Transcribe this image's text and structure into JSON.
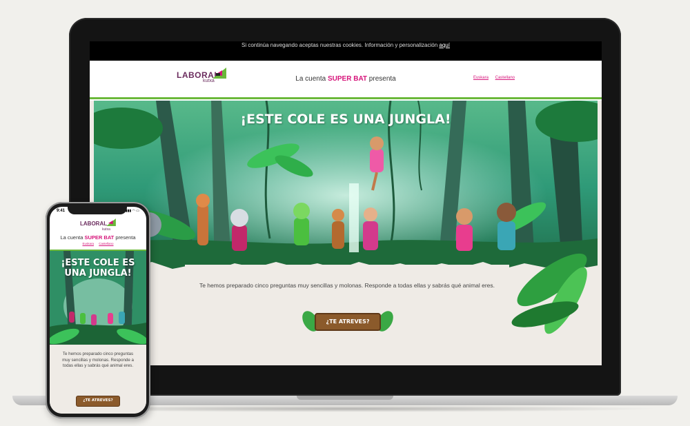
{
  "desktop": {
    "cookie_bar": {
      "text": "Si continúa navegando aceptas nuestras cookies. Información y personalización ",
      "link": "aquí"
    },
    "header": {
      "logo_text": "LABORAL",
      "logo_sub": "kutxa",
      "title_prefix": "La cuenta ",
      "title_highlight": "SUPER BAT",
      "title_suffix": " presenta",
      "languages": [
        "Euskara",
        "Castellano"
      ]
    },
    "hero": {
      "title": "¡ESTE COLE ES UNA JUNGLA!",
      "intro": "Te hemos preparado cinco preguntas muy sencillas y molonas. Responde a todas ellas y sabrás qué animal eres.",
      "cta_label": "¿TE ATREVES?"
    }
  },
  "mobile": {
    "status_time": "9:41",
    "status_icons": "▮▮▮ ◠ ▭",
    "header": {
      "logo_text": "LABORAL",
      "logo_sub": "kutxa",
      "title_prefix": "La cuenta ",
      "title_highlight": "SUPER BAT",
      "title_suffix": " presenta",
      "languages": [
        "Euskara",
        "Castellano"
      ]
    },
    "hero": {
      "title": "¡ESTE COLE ES UNA JUNGLA!",
      "intro": "Te hemos preparado cinco preguntas muy sencillas y molonas. Responde a todas ellas y sabrás qué animal eres.",
      "cta_label": "¿TE ATREVES?"
    }
  },
  "colors": {
    "brand_purple": "#6b2c5e",
    "accent_pink": "#d6147a",
    "accent_green": "#6ab83a",
    "button_wood": "#8b5a2b"
  }
}
